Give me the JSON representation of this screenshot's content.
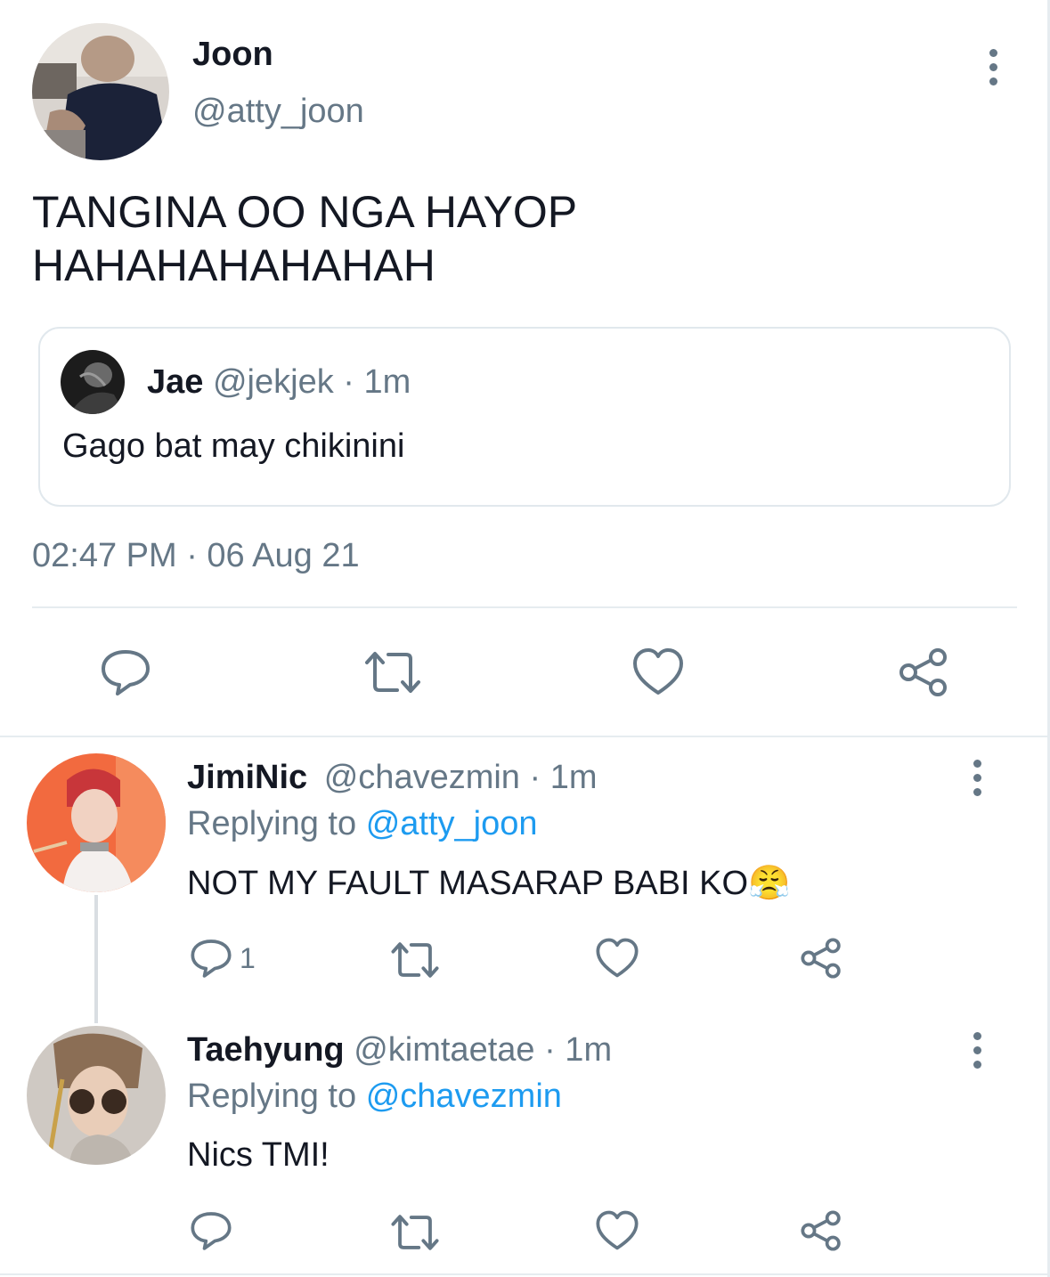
{
  "tweet": {
    "author_name": "Joon",
    "author_handle": "@atty_joon",
    "text_line1": "TANGINA OO NGA HAYOP",
    "text_line2": "HAHAHAHAHAHAH",
    "quote": {
      "name": "Jae",
      "handle": "@jekjek",
      "time": "· 1m",
      "text": "Gago bat may chikinini"
    },
    "timestamp": "02:47 PM · 06 Aug 21",
    "actions": [
      "reply-icon",
      "retweet-icon",
      "like-icon",
      "share-icon"
    ]
  },
  "replies": [
    {
      "name": "JimiNic",
      "handle": "@chavezmin",
      "time": "· 1m",
      "replying_prefix": "Replying to",
      "replying_to": "@atty_joon",
      "text": "NOT MY FAULT MASARAP BABI KO",
      "emoji": "😤",
      "reply_count": "1"
    },
    {
      "name": "Taehyung",
      "handle": "@kimtaetae",
      "time": "· 1m",
      "replying_prefix": "Replying to",
      "replying_to": "@chavezmin",
      "text": "Nics TMI!",
      "reply_count": ""
    }
  ],
  "colors": {
    "text": "#141823",
    "muted": "#657786",
    "link": "#1d9bf0",
    "border": "#e1e8ed"
  }
}
